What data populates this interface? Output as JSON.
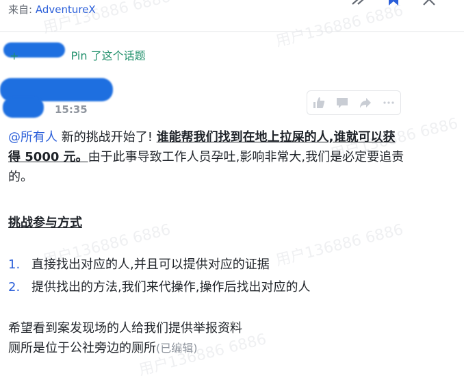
{
  "header": {
    "from_label": "来自:",
    "source_name": "AdventureX"
  },
  "pin": {
    "label": "Pin 了这个话题"
  },
  "message": {
    "time": "15:35",
    "mention": "@所有人",
    "text_a": " 新的挑战开始了!",
    "highlight": "谁能帮我们找到在地上拉屎的人,谁就可以获得 5000 元。",
    "text_b": "由于此事导致工作人员孕吐,影响非常大,我们是必定要追责的。",
    "section_title": "挑战参与方式",
    "list": [
      {
        "num": "1.",
        "text": "直接找出对应的人,并且可以提供对应的证据"
      },
      {
        "num": "2.",
        "text": "提供找出的方法,我们来代操作,操作后找出对应的人"
      }
    ],
    "footer_line1": "希望看到案发现场的人给我们提供举报资料",
    "footer_line2": "厕所是位于公社旁边的厕所",
    "edited": "(已编辑)"
  },
  "watermark": "用户136886 6886",
  "icons": [
    "forward-icon",
    "bookmark-icon",
    "close-icon",
    "thumbs-up-icon",
    "comment-icon",
    "share-icon",
    "more-icon"
  ],
  "colors": {
    "link": "#2b5fd9",
    "muted": "#8f959e",
    "redaction": "#1e6fe0"
  }
}
